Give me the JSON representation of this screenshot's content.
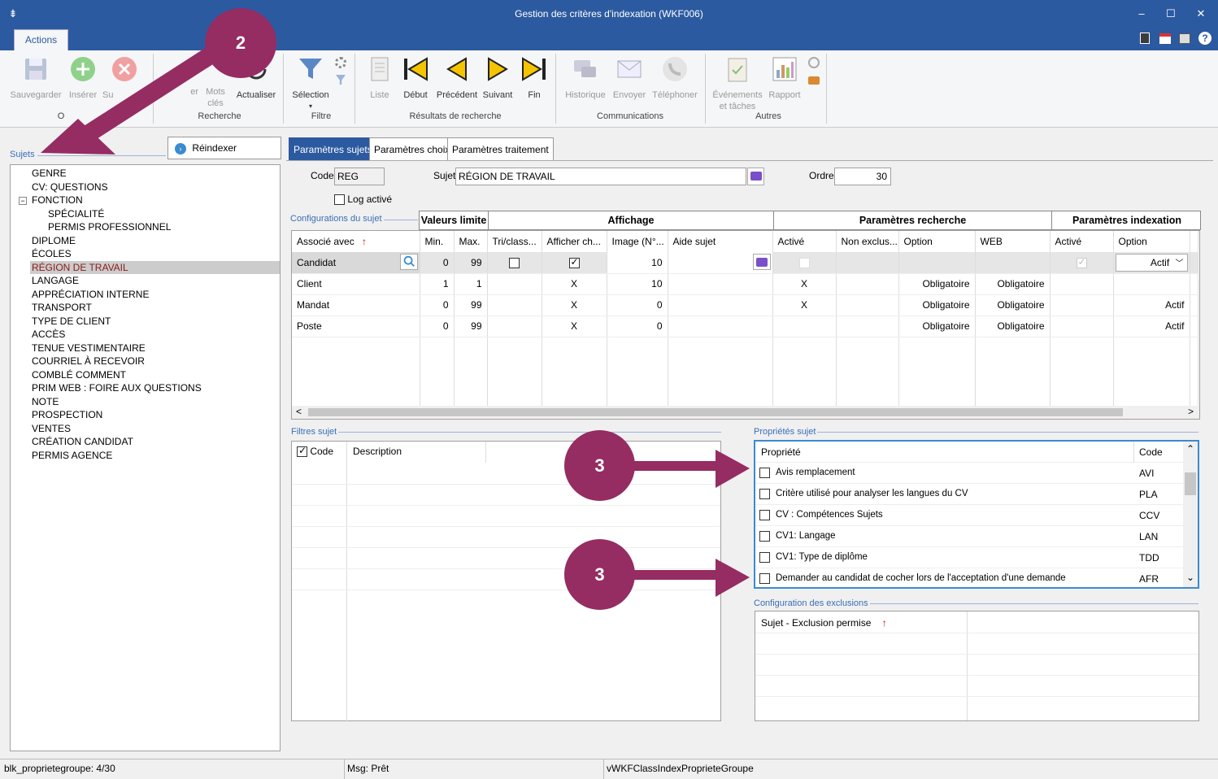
{
  "window": {
    "title": "Gestion des critères d'indexation (WKF006)",
    "menu_glyph": "⇟",
    "minimize": "–",
    "maximize": "☐",
    "close": "✕"
  },
  "ribbon_tab": "Actions",
  "ribbon": {
    "save": "Sauvegarder",
    "insert": "Insérer",
    "delete": "Su",
    "keywords": "Mots clés",
    "keywords2": "clés",
    "refresh": "Actualiser",
    "selection": "Sélection",
    "list": "Liste",
    "first": "Début",
    "prev": "Précédent",
    "next": "Suivant",
    "last": "Fin",
    "history": "Historique",
    "send": "Envoyer",
    "phone": "Téléphoner",
    "events": "Événements",
    "events2": "et tâches",
    "report": "Rapport",
    "groups": {
      "o": "O",
      "search": "Recherche",
      "filter": "Filtre",
      "results": "Résultats de recherche",
      "comm": "Communications",
      "others": "Autres"
    },
    "partial_er": "er"
  },
  "left": {
    "label": "Sujets",
    "reindex": "Réindexer",
    "tree": [
      "GENRE",
      "CV: QUESTIONS",
      "FONCTION",
      "SPÉCIALITÉ",
      "PERMIS PROFESSIONNEL",
      "DIPLOME",
      "ÉCOLES",
      "RÉGION DE TRAVAIL",
      "LANGAGE",
      "APPRÉCIATION INTERNE",
      "TRANSPORT",
      "TYPE DE CLIENT",
      "ACCÈS",
      "TENUE VESTIMENTAIRE",
      "COURRIEL À RECEVOIR",
      "COMBLÉ COMMENT",
      "PRIM WEB : FOIRE AUX QUESTIONS",
      "NOTE",
      "PROSPECTION",
      "VENTES",
      "CRÉATION CANDIDAT",
      "PERMIS AGENCE"
    ],
    "expander": "−"
  },
  "tabs": [
    "Paramètres sujets",
    "Paramètres choix",
    "Paramètres traitement"
  ],
  "form": {
    "code_label": "Code",
    "code_value": "REG",
    "subject_label": "Sujet",
    "subject_value": "RÉGION DE TRAVAIL",
    "order_label": "Ordre",
    "order_value": "30",
    "log_label": "Log activé"
  },
  "config": {
    "label": "Configurations du sujet",
    "groups": [
      "Valeurs limite",
      "Affichage",
      "Paramètres recherche",
      "Paramètres indexation"
    ],
    "headers": [
      "Associé avec",
      "Min.",
      "Max.",
      "Tri/class...",
      "Afficher ch...",
      "Image (N°...",
      "Aide sujet",
      "Activé",
      "Non exclus...",
      "Option",
      "WEB",
      "Activé",
      "Option"
    ],
    "sort_icon": "↑",
    "rows": [
      {
        "assoc": "Candidat",
        "min": "0",
        "max": "99",
        "image": "10",
        "rech_opt": "",
        "web": "",
        "idx_opt": "Actif"
      },
      {
        "assoc": "Client",
        "min": "1",
        "max": "1",
        "tri": "",
        "aff": "X",
        "image": "10",
        "actif": "X",
        "rech_opt": "Obligatoire",
        "web": "Obligatoire",
        "idx_opt": ""
      },
      {
        "assoc": "Mandat",
        "min": "0",
        "max": "99",
        "tri": "",
        "aff": "X",
        "image": "0",
        "actif": "X",
        "rech_opt": "Obligatoire",
        "web": "Obligatoire",
        "idx_opt": "Actif"
      },
      {
        "assoc": "Poste",
        "min": "0",
        "max": "99",
        "tri": "",
        "aff": "X",
        "image": "0",
        "actif": "",
        "rech_opt": "Obligatoire",
        "web": "Obligatoire",
        "idx_opt": "Actif"
      }
    ],
    "scroll_left": "<",
    "scroll_right": ">"
  },
  "filters": {
    "label": "Filtres sujet",
    "col_code": "Code",
    "col_desc": "Description"
  },
  "props": {
    "label": "Propriétés sujet",
    "col_prop": "Propriété",
    "col_code": "Code",
    "rows": [
      {
        "name": "Avis remplacement",
        "code": "AVI"
      },
      {
        "name": "Critère utilisé pour analyser les langues du CV",
        "code": "PLA"
      },
      {
        "name": "CV : Compétences Sujets",
        "code": "CCV"
      },
      {
        "name": "CV1: Langage",
        "code": "LAN"
      },
      {
        "name": "CV1: Type de diplôme",
        "code": "TDD"
      },
      {
        "name": "Demander au candidat de cocher lors de l'acceptation d'une demande",
        "code": "AFR"
      }
    ],
    "up": "⌃",
    "down": "⌄"
  },
  "exclusions": {
    "label": "Configuration des exclusions",
    "col": "Sujet - Exclusion permise"
  },
  "annotations": {
    "a2": "2",
    "a3": "3"
  },
  "status": {
    "left": "blk_proprietegroupe: 4/30",
    "mid": "Msg: Prêt",
    "right": "vWKFClassIndexProprieteGroupe"
  }
}
